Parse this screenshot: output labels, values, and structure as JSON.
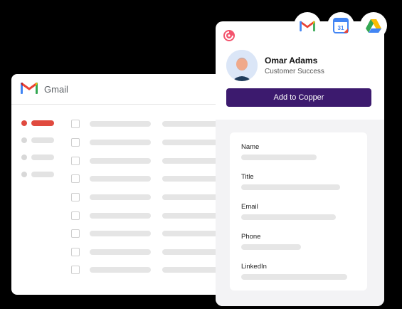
{
  "gmail": {
    "title": "Gmail",
    "icon": "gmail-icon"
  },
  "copper": {
    "logo_icon": "copper-logo-icon",
    "contact": {
      "name": "Omar Adams",
      "role": "Customer Success",
      "avatar_icon": "avatar"
    },
    "add_button": "Add to Copper",
    "accent": "#3c1a6e",
    "fields": [
      "Name",
      "Title",
      "Email",
      "Phone",
      "LinkedIn"
    ]
  },
  "integrations": [
    "gmail-icon",
    "google-calendar-icon",
    "google-drive-icon"
  ],
  "calendar_day": "31",
  "colors": {
    "gmail_red": "#e04a3f",
    "copper_pink": "#f3546d"
  }
}
